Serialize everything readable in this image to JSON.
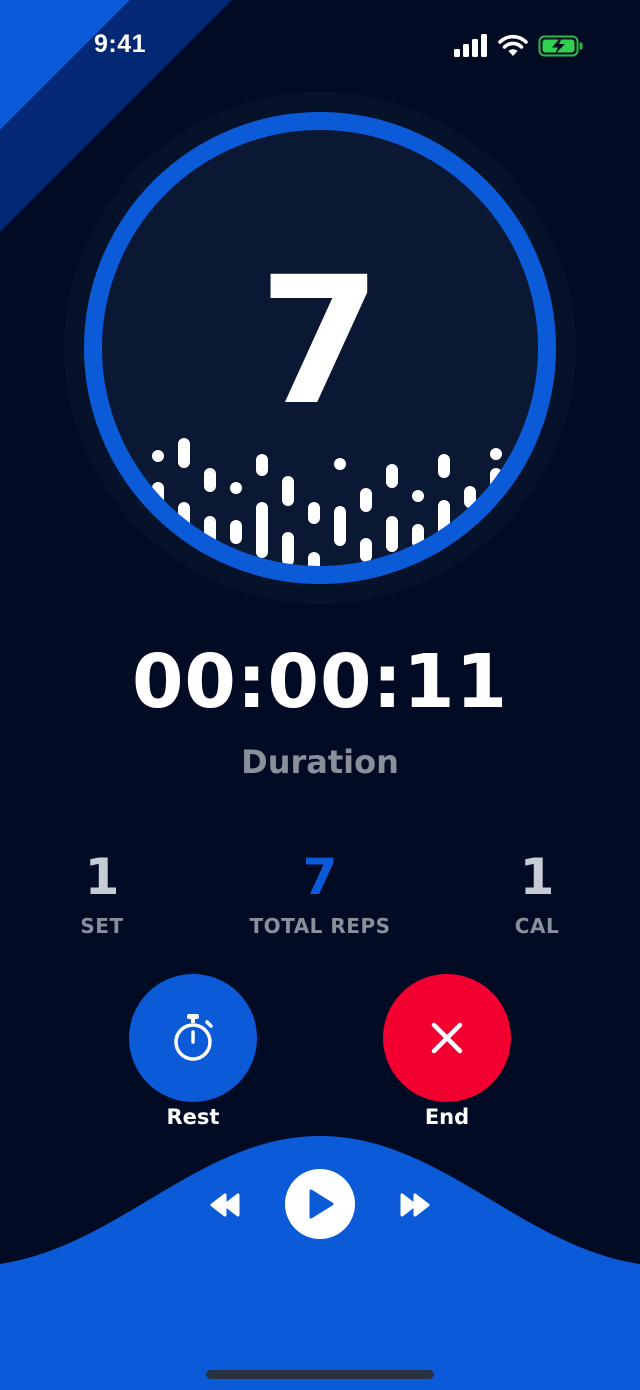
{
  "status_bar": {
    "time": "9:41",
    "icons": [
      "cellular-signal-icon",
      "wifi-icon",
      "battery-charging-icon"
    ]
  },
  "counter": {
    "reps": "7"
  },
  "duration": {
    "value": "00:00:11",
    "label": "Duration"
  },
  "stats": [
    {
      "value": "1",
      "label": "SET"
    },
    {
      "value": "7",
      "label": "TOTAL REPS"
    },
    {
      "value": "1",
      "label": "CAL"
    }
  ],
  "actions": {
    "rest": {
      "label": "Rest",
      "icon": "stopwatch-icon"
    },
    "end": {
      "label": "End",
      "icon": "close-icon"
    }
  },
  "player": {
    "icons": [
      "rewind-icon",
      "play-icon",
      "fast-forward-icon"
    ]
  },
  "colors": {
    "background": "#020b24",
    "accent": "#0b5ad8",
    "danger": "#f2002f",
    "ring_inner": "#0a1834",
    "muted_text": "#8a8f9b"
  }
}
